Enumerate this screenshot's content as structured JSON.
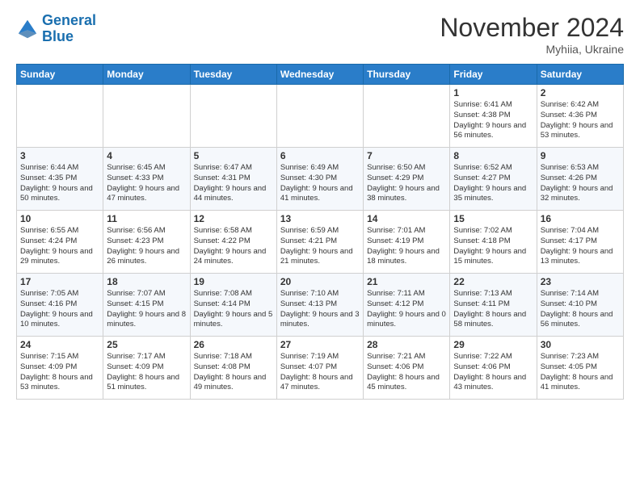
{
  "logo": {
    "line1": "General",
    "line2": "Blue"
  },
  "title": "November 2024",
  "location": "Myhiia, Ukraine",
  "headers": [
    "Sunday",
    "Monday",
    "Tuesday",
    "Wednesday",
    "Thursday",
    "Friday",
    "Saturday"
  ],
  "weeks": [
    [
      {
        "day": "",
        "info": ""
      },
      {
        "day": "",
        "info": ""
      },
      {
        "day": "",
        "info": ""
      },
      {
        "day": "",
        "info": ""
      },
      {
        "day": "",
        "info": ""
      },
      {
        "day": "1",
        "info": "Sunrise: 6:41 AM\nSunset: 4:38 PM\nDaylight: 9 hours and 56 minutes."
      },
      {
        "day": "2",
        "info": "Sunrise: 6:42 AM\nSunset: 4:36 PM\nDaylight: 9 hours and 53 minutes."
      }
    ],
    [
      {
        "day": "3",
        "info": "Sunrise: 6:44 AM\nSunset: 4:35 PM\nDaylight: 9 hours and 50 minutes."
      },
      {
        "day": "4",
        "info": "Sunrise: 6:45 AM\nSunset: 4:33 PM\nDaylight: 9 hours and 47 minutes."
      },
      {
        "day": "5",
        "info": "Sunrise: 6:47 AM\nSunset: 4:31 PM\nDaylight: 9 hours and 44 minutes."
      },
      {
        "day": "6",
        "info": "Sunrise: 6:49 AM\nSunset: 4:30 PM\nDaylight: 9 hours and 41 minutes."
      },
      {
        "day": "7",
        "info": "Sunrise: 6:50 AM\nSunset: 4:29 PM\nDaylight: 9 hours and 38 minutes."
      },
      {
        "day": "8",
        "info": "Sunrise: 6:52 AM\nSunset: 4:27 PM\nDaylight: 9 hours and 35 minutes."
      },
      {
        "day": "9",
        "info": "Sunrise: 6:53 AM\nSunset: 4:26 PM\nDaylight: 9 hours and 32 minutes."
      }
    ],
    [
      {
        "day": "10",
        "info": "Sunrise: 6:55 AM\nSunset: 4:24 PM\nDaylight: 9 hours and 29 minutes."
      },
      {
        "day": "11",
        "info": "Sunrise: 6:56 AM\nSunset: 4:23 PM\nDaylight: 9 hours and 26 minutes."
      },
      {
        "day": "12",
        "info": "Sunrise: 6:58 AM\nSunset: 4:22 PM\nDaylight: 9 hours and 24 minutes."
      },
      {
        "day": "13",
        "info": "Sunrise: 6:59 AM\nSunset: 4:21 PM\nDaylight: 9 hours and 21 minutes."
      },
      {
        "day": "14",
        "info": "Sunrise: 7:01 AM\nSunset: 4:19 PM\nDaylight: 9 hours and 18 minutes."
      },
      {
        "day": "15",
        "info": "Sunrise: 7:02 AM\nSunset: 4:18 PM\nDaylight: 9 hours and 15 minutes."
      },
      {
        "day": "16",
        "info": "Sunrise: 7:04 AM\nSunset: 4:17 PM\nDaylight: 9 hours and 13 minutes."
      }
    ],
    [
      {
        "day": "17",
        "info": "Sunrise: 7:05 AM\nSunset: 4:16 PM\nDaylight: 9 hours and 10 minutes."
      },
      {
        "day": "18",
        "info": "Sunrise: 7:07 AM\nSunset: 4:15 PM\nDaylight: 9 hours and 8 minutes."
      },
      {
        "day": "19",
        "info": "Sunrise: 7:08 AM\nSunset: 4:14 PM\nDaylight: 9 hours and 5 minutes."
      },
      {
        "day": "20",
        "info": "Sunrise: 7:10 AM\nSunset: 4:13 PM\nDaylight: 9 hours and 3 minutes."
      },
      {
        "day": "21",
        "info": "Sunrise: 7:11 AM\nSunset: 4:12 PM\nDaylight: 9 hours and 0 minutes."
      },
      {
        "day": "22",
        "info": "Sunrise: 7:13 AM\nSunset: 4:11 PM\nDaylight: 8 hours and 58 minutes."
      },
      {
        "day": "23",
        "info": "Sunrise: 7:14 AM\nSunset: 4:10 PM\nDaylight: 8 hours and 56 minutes."
      }
    ],
    [
      {
        "day": "24",
        "info": "Sunrise: 7:15 AM\nSunset: 4:09 PM\nDaylight: 8 hours and 53 minutes."
      },
      {
        "day": "25",
        "info": "Sunrise: 7:17 AM\nSunset: 4:09 PM\nDaylight: 8 hours and 51 minutes."
      },
      {
        "day": "26",
        "info": "Sunrise: 7:18 AM\nSunset: 4:08 PM\nDaylight: 8 hours and 49 minutes."
      },
      {
        "day": "27",
        "info": "Sunrise: 7:19 AM\nSunset: 4:07 PM\nDaylight: 8 hours and 47 minutes."
      },
      {
        "day": "28",
        "info": "Sunrise: 7:21 AM\nSunset: 4:06 PM\nDaylight: 8 hours and 45 minutes."
      },
      {
        "day": "29",
        "info": "Sunrise: 7:22 AM\nSunset: 4:06 PM\nDaylight: 8 hours and 43 minutes."
      },
      {
        "day": "30",
        "info": "Sunrise: 7:23 AM\nSunset: 4:05 PM\nDaylight: 8 hours and 41 minutes."
      }
    ]
  ]
}
